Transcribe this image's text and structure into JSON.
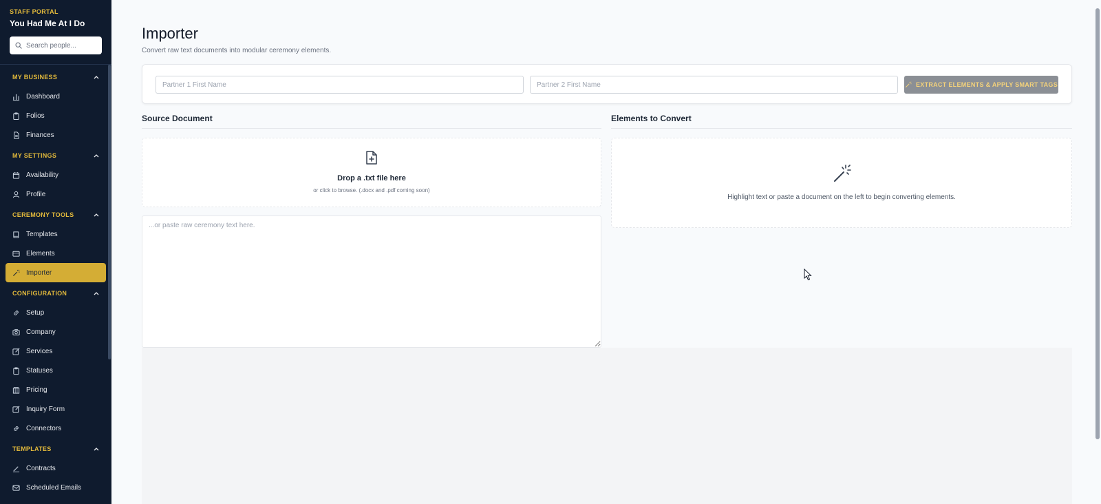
{
  "sidebar": {
    "eyebrow": "STAFF PORTAL",
    "business_name": "You Had Me At I Do",
    "search_placeholder": "Search people...",
    "sections": [
      {
        "title": "MY BUSINESS",
        "items": [
          "Dashboard",
          "Folios",
          "Finances"
        ]
      },
      {
        "title": "MY SETTINGS",
        "items": [
          "Availability",
          "Profile"
        ]
      },
      {
        "title": "CEREMONY TOOLS",
        "items": [
          "Templates",
          "Elements",
          "Importer"
        ]
      },
      {
        "title": "CONFIGURATION",
        "items": [
          "Setup",
          "Company",
          "Services",
          "Statuses",
          "Pricing",
          "Inquiry Form",
          "Connectors"
        ]
      },
      {
        "title": "TEMPLATES",
        "items": [
          "Contracts",
          "Scheduled Emails"
        ]
      }
    ],
    "active_item": "Importer",
    "accent_color": "#e2b93b"
  },
  "page": {
    "title": "Importer",
    "subtitle": "Convert raw text documents into modular ceremony elements."
  },
  "form": {
    "partner1_placeholder": "Partner 1 First Name",
    "partner2_placeholder": "Partner 2 First Name",
    "extract_label": "EXTRACT ELEMENTS & APPLY SMART TAGS"
  },
  "source": {
    "heading": "Source Document",
    "drop_title": "Drop a .txt file here",
    "drop_subtitle": "or click to browse. (.docx and .pdf coming soon)",
    "paste_placeholder": "...or paste raw ceremony text here."
  },
  "elements": {
    "heading": "Elements to Convert",
    "empty_hint": "Highlight text or paste a document on the left to begin converting elements."
  }
}
